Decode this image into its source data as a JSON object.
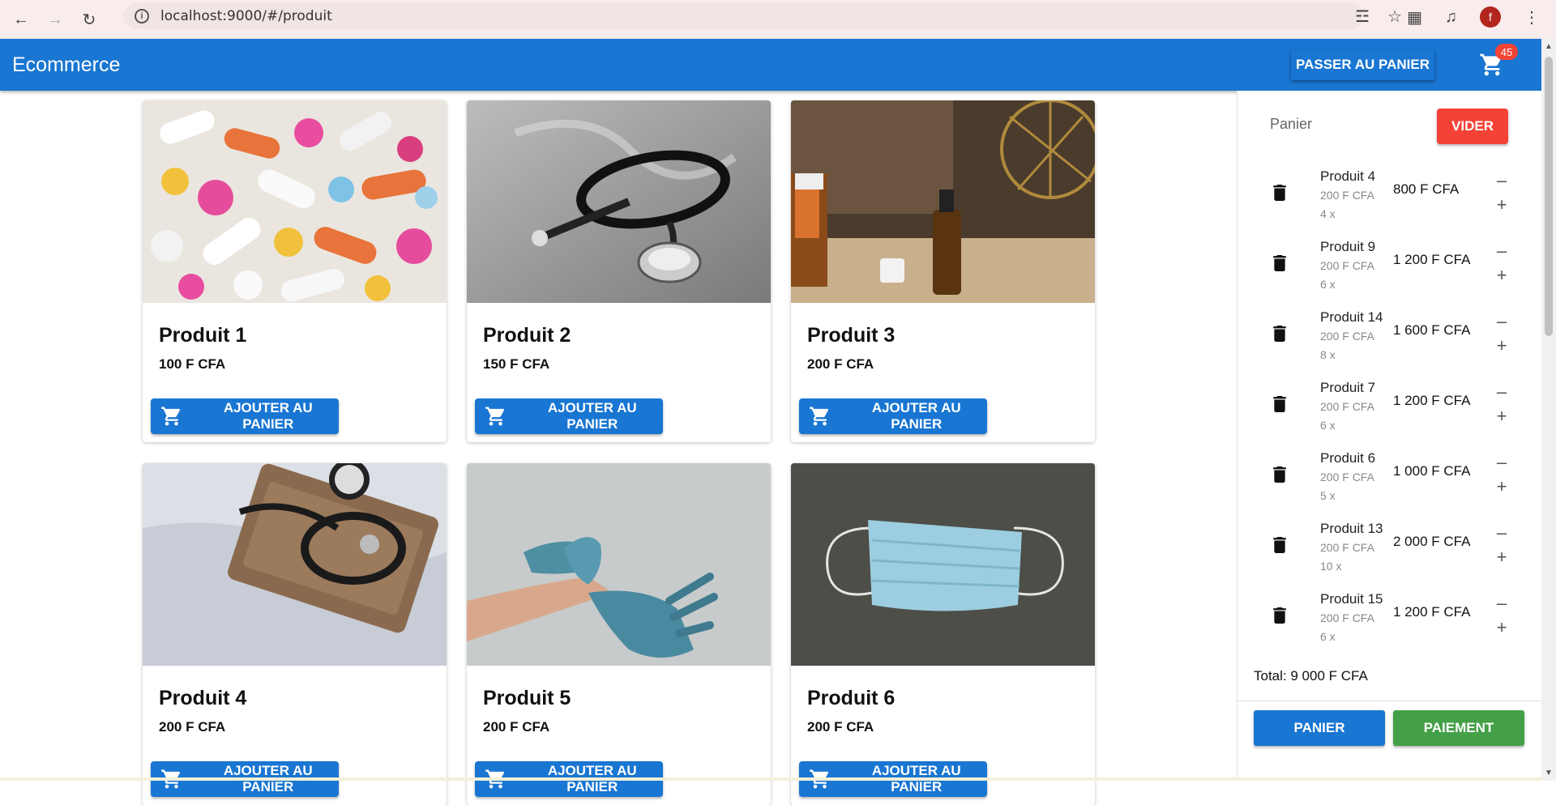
{
  "browser": {
    "url": "localhost:9000/#/produit",
    "profile_initial": "f"
  },
  "header": {
    "title": "Ecommerce",
    "go_to_cart_label": "PASSER AU PANIER",
    "cart_count": "45"
  },
  "products": [
    {
      "name": "Produit 1",
      "price": "100 F CFA",
      "button": "AJOUTER AU PANIER",
      "image": "pills"
    },
    {
      "name": "Produit 2",
      "price": "150 F CFA",
      "button": "AJOUTER AU PANIER",
      "image": "stethoscope"
    },
    {
      "name": "Produit 3",
      "price": "200 F CFA",
      "button": "AJOUTER AU PANIER",
      "image": "bottles"
    },
    {
      "name": "Produit 4",
      "price": "200 F CFA",
      "button": "AJOUTER AU PANIER",
      "image": "blood-pressure"
    },
    {
      "name": "Produit 5",
      "price": "200 F CFA",
      "button": "AJOUTER AU PANIER",
      "image": "gloves"
    },
    {
      "name": "Produit 6",
      "price": "200 F CFA",
      "button": "AJOUTER AU PANIER",
      "image": "mask"
    }
  ],
  "cart": {
    "label": "Panier",
    "clear_label": "VIDER",
    "items": [
      {
        "name": "Produit 4",
        "unit": "200 F CFA",
        "qty": "4 x",
        "total": "800 F CFA"
      },
      {
        "name": "Produit 9",
        "unit": "200 F CFA",
        "qty": "6 x",
        "total": "1 200 F CFA"
      },
      {
        "name": "Produit 14",
        "unit": "200 F CFA",
        "qty": "8 x",
        "total": "1 600 F CFA"
      },
      {
        "name": "Produit 7",
        "unit": "200 F CFA",
        "qty": "6 x",
        "total": "1 200 F CFA"
      },
      {
        "name": "Produit 6",
        "unit": "200 F CFA",
        "qty": "5 x",
        "total": "1 000 F CFA"
      },
      {
        "name": "Produit 13",
        "unit": "200 F CFA",
        "qty": "10 x",
        "total": "2 000 F CFA"
      },
      {
        "name": "Produit 15",
        "unit": "200 F CFA",
        "qty": "6 x",
        "total": "1 200 F CFA"
      }
    ],
    "total": "Total: 9 000 F CFA",
    "cart_button": "PANIER",
    "pay_button": "PAIEMENT"
  },
  "colors": {
    "primary": "#1976d2",
    "danger": "#f44336",
    "success": "#43a047"
  }
}
